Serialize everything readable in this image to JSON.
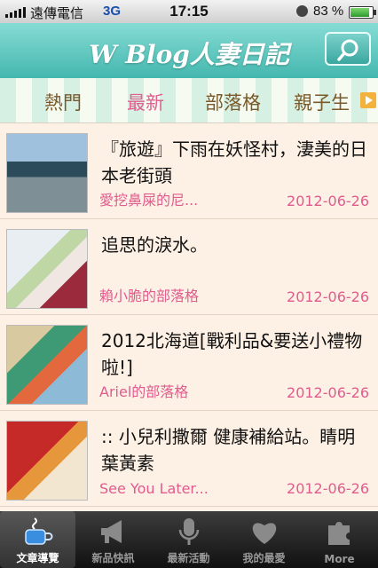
{
  "status_bar": {
    "carrier": "遠傳電信",
    "network": "3G",
    "time": "17:15",
    "battery": "83 %"
  },
  "header": {
    "title": "W Blog人妻日記",
    "search_icon": "search-icon"
  },
  "tabs": [
    {
      "label": "熱門",
      "active": false
    },
    {
      "label": "最新",
      "active": true
    },
    {
      "label": "部落格",
      "active": false
    },
    {
      "label": "親子生",
      "active": false
    }
  ],
  "articles": [
    {
      "headline": "『旅遊』下雨在妖怪村，淒美的日本老街頭",
      "source": "愛挖鼻屎的尼...",
      "date": "2012-06-26"
    },
    {
      "headline": "追思的淚水。",
      "source": "賴小脆的部落格",
      "date": "2012-06-26"
    },
    {
      "headline": "2012北海道[戰利品&要送小禮物啦!]",
      "source": "Ariel的部落格",
      "date": "2012-06-26"
    },
    {
      "headline": ":: 小兒利撒爾 健康補給站。睛明葉黃素",
      "source": "See You Later...",
      "date": "2012-06-26"
    }
  ],
  "tab_bar": [
    {
      "label": "文章導覽",
      "icon": "coffee-cup-icon",
      "active": true
    },
    {
      "label": "新品快訊",
      "icon": "megaphone-icon",
      "active": false
    },
    {
      "label": "最新活動",
      "icon": "microphone-icon",
      "active": false
    },
    {
      "label": "我的最愛",
      "icon": "heart-icon",
      "active": false
    },
    {
      "label": "More",
      "icon": "puzzle-icon",
      "active": false
    }
  ],
  "colors": {
    "header": "#44b7ae",
    "accent_pink": "#e15c8e",
    "tab_text": "#7a5a2a",
    "list_bg": "#fdf0e4"
  }
}
